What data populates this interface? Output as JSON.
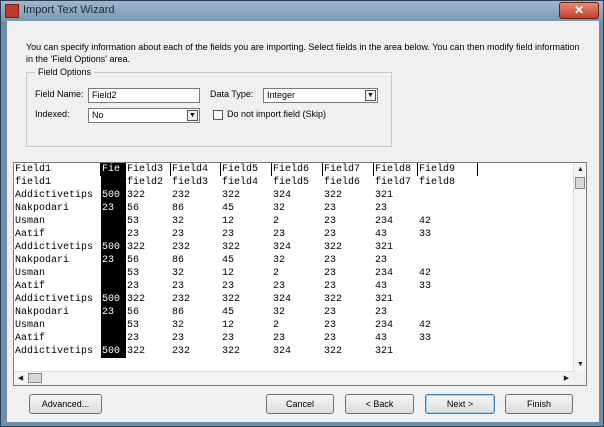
{
  "window": {
    "title": "Import Text Wizard",
    "close_label": "✕"
  },
  "intro": "You can specify information about each of the fields you are importing. Select fields in the area below. You can then modify field information in the 'Field Options' area.",
  "field_options": {
    "legend": "Field Options",
    "field_name_label": "Field Name:",
    "field_name_value": "Field2",
    "data_type_label": "Data Type:",
    "data_type_value": "Integer",
    "indexed_label": "Indexed:",
    "indexed_value": "No",
    "do_not_import_label": "Do not import field (Skip)",
    "do_not_import_checked": false
  },
  "grid": {
    "headers": [
      "Field1",
      "Fie",
      "Field3",
      "Field4",
      "Field5",
      "Field6",
      "Field7",
      "Field8",
      "Field9"
    ],
    "selected_column": 1,
    "rows": [
      [
        "field1",
        "",
        "field2",
        "field3",
        "field4",
        "field5",
        "field6",
        "field7",
        "field8"
      ],
      [
        "Addictivetips",
        "500",
        "322",
        "232",
        "322",
        "324",
        "322",
        "321",
        ""
      ],
      [
        "Nakpodari",
        "23",
        "56",
        "86",
        "45",
        "32",
        "23",
        "23",
        ""
      ],
      [
        "Usman",
        "",
        "53",
        "32",
        "12",
        "2",
        "23",
        "234",
        "42"
      ],
      [
        "Aatif",
        "",
        "23",
        "23",
        "23",
        "23",
        "23",
        "43",
        "33"
      ],
      [
        "Addictivetips",
        "500",
        "322",
        "232",
        "322",
        "324",
        "322",
        "321",
        ""
      ],
      [
        "Nakpodari",
        "23",
        "56",
        "86",
        "45",
        "32",
        "23",
        "23",
        ""
      ],
      [
        "Usman",
        "",
        "53",
        "32",
        "12",
        "2",
        "23",
        "234",
        "42"
      ],
      [
        "Aatif",
        "",
        "23",
        "23",
        "23",
        "23",
        "23",
        "43",
        "33"
      ],
      [
        "Addictivetips",
        "500",
        "322",
        "232",
        "322",
        "324",
        "322",
        "321",
        ""
      ],
      [
        "Nakpodari",
        "23",
        "56",
        "86",
        "45",
        "32",
        "23",
        "23",
        ""
      ],
      [
        "Usman",
        "",
        "53",
        "32",
        "12",
        "2",
        "23",
        "234",
        "42"
      ],
      [
        "Aatif",
        "",
        "23",
        "23",
        "23",
        "23",
        "23",
        "43",
        "33"
      ],
      [
        "Addictivetips",
        "500",
        "322",
        "232",
        "322",
        "324",
        "322",
        "321",
        ""
      ]
    ]
  },
  "buttons": {
    "advanced": "Advanced...",
    "cancel": "Cancel",
    "back": "< Back",
    "next": "Next >",
    "finish": "Finish"
  }
}
